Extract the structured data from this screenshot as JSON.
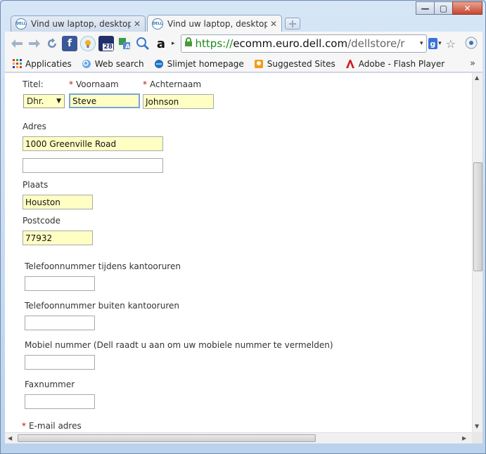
{
  "window": {
    "minimize": "—",
    "maximize": "▢",
    "close": "✕"
  },
  "tabs": [
    {
      "favicon": "DELL",
      "title": "Vind uw laptop, desktop, s",
      "close": "✕"
    },
    {
      "favicon": "DELL",
      "title": "Vind uw laptop, desktop, s",
      "close": "✕"
    }
  ],
  "toolbar": {
    "back_icon": "back-arrow-icon",
    "forward_icon": "forward-arrow-icon",
    "reload_icon": "reload-icon",
    "ext_badge": "28",
    "url_scheme": "https://",
    "url_host": "ecomm.euro.dell.com",
    "url_path": "/dellstore/r",
    "search_engine": "g",
    "accent": "#1b8a1b"
  },
  "bookmarks": [
    {
      "label": "Applicaties",
      "icon": "apps-grid-icon"
    },
    {
      "label": "Web search",
      "icon": "web-search-icon"
    },
    {
      "label": "Slimjet homepage",
      "icon": "slimjet-icon"
    },
    {
      "label": "Suggested Sites",
      "icon": "suggested-sites-icon"
    },
    {
      "label": "Adobe - Flash Player",
      "icon": "adobe-icon"
    }
  ],
  "bookmarks_more": "»",
  "form": {
    "title_label": "Titel:",
    "title_value": "Dhr.",
    "required_mark": "*",
    "firstname_label": "Voornaam",
    "firstname_value": "Steve",
    "lastname_label": "Achternaam",
    "lastname_value": "Johnson",
    "address_label": "Adres",
    "address1_value": "1000 Greenville Road",
    "address2_value": "",
    "city_label": "Plaats",
    "city_value": "Houston",
    "postcode_label": "Postcode",
    "postcode_value": "77932",
    "phone_work_label": "Telefoonnummer tijdens kantooruren",
    "phone_home_label": "Telefoonnummer buiten kantooruren",
    "mobile_label": "Mobiel nummer (Dell raadt u aan om uw mobiele nummer te vermelden)",
    "fax_label": "Faxnummer",
    "email_label": "E-mail adres",
    "filled_color": "#ffffc4"
  }
}
